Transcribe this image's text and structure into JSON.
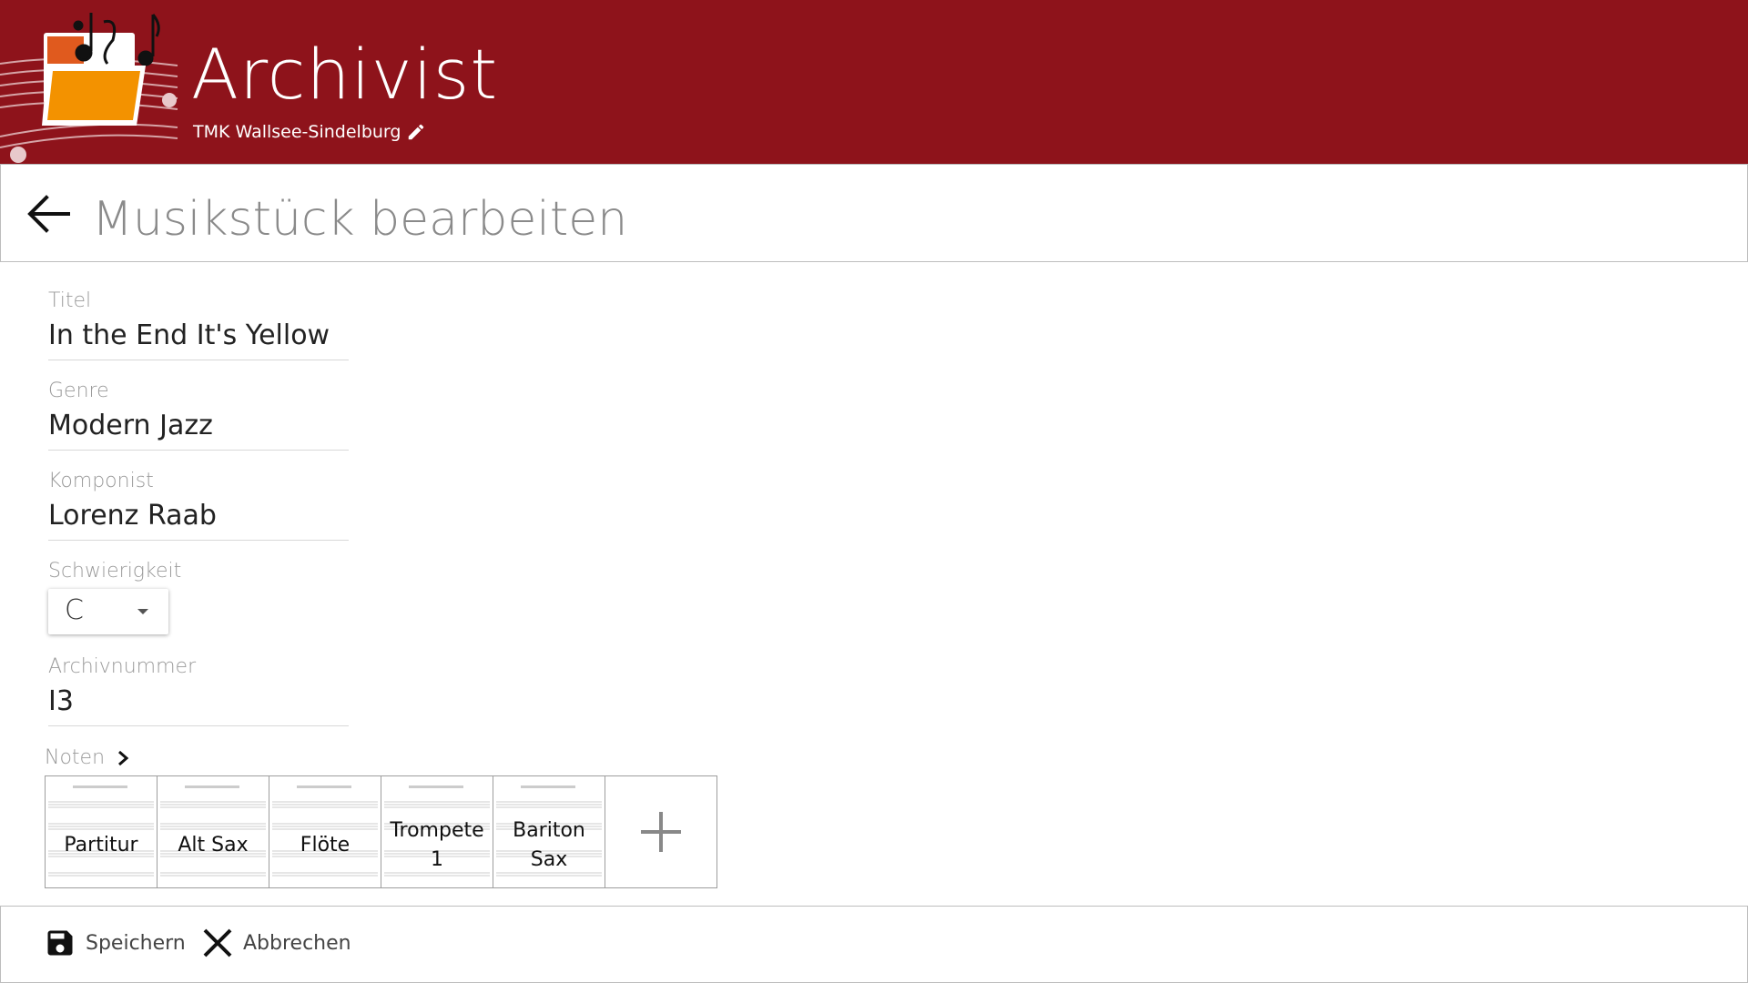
{
  "header": {
    "app_title": "Archivist",
    "organization": "TMK Wallsee-Sindelburg",
    "bg_color": "#8e131b",
    "logo_color": "#f39200"
  },
  "page": {
    "title": "Musikstück bearbeiten"
  },
  "form": {
    "titel": {
      "label": "Titel",
      "value": "In the End It's Yellow"
    },
    "genre": {
      "label": "Genre",
      "value": "Modern Jazz"
    },
    "komponist": {
      "label": "Komponist",
      "value": "Lorenz Raab"
    },
    "schwierigkeit": {
      "label": "Schwierigkeit",
      "value": "C"
    },
    "archivnummer": {
      "label": "Archivnummer",
      "value": "I3"
    }
  },
  "noten": {
    "label": "Noten",
    "items": [
      {
        "label": "Partitur"
      },
      {
        "label": "Alt Sax"
      },
      {
        "label": "Flöte"
      },
      {
        "label": "Trompete 1"
      },
      {
        "label": "Bariton Sax"
      }
    ]
  },
  "footer": {
    "save_label": "Speichern",
    "cancel_label": "Abbrechen"
  }
}
